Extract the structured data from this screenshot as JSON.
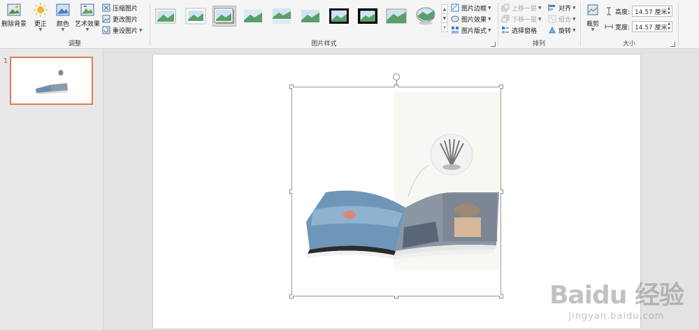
{
  "adjust_group": {
    "remove_bg": "删除背景",
    "corrections": "更正",
    "color": "颜色",
    "artistic": "艺术效果",
    "compress": "压缩图片",
    "change_pic": "更改图片",
    "reset_pic": "重设图片",
    "label": "调整"
  },
  "styles_group": {
    "label": "图片样式",
    "border": "图片边框",
    "effects": "图片效果",
    "layout": "图片版式"
  },
  "arrange_group": {
    "label": "排列",
    "bring_forward": "上移一层",
    "send_backward": "下移一层",
    "selection_pane": "选择窗格",
    "align": "对齐",
    "group": "组合",
    "rotate": "旋转"
  },
  "size_group": {
    "label": "大小",
    "crop": "裁剪",
    "height_label": "高度:",
    "height_value": "14.57 厘米",
    "width_label": "宽度:",
    "width_value": "14.57 厘米"
  },
  "thumbnails": {
    "slide_number": "1"
  },
  "watermark": {
    "main": "Baidu 经验",
    "sub": "jingyan.baidu.com"
  },
  "colors": {
    "accent": "#e07b53",
    "ribbon_bg": "#f5f5f5",
    "selected_style": "#d9d9d9"
  }
}
